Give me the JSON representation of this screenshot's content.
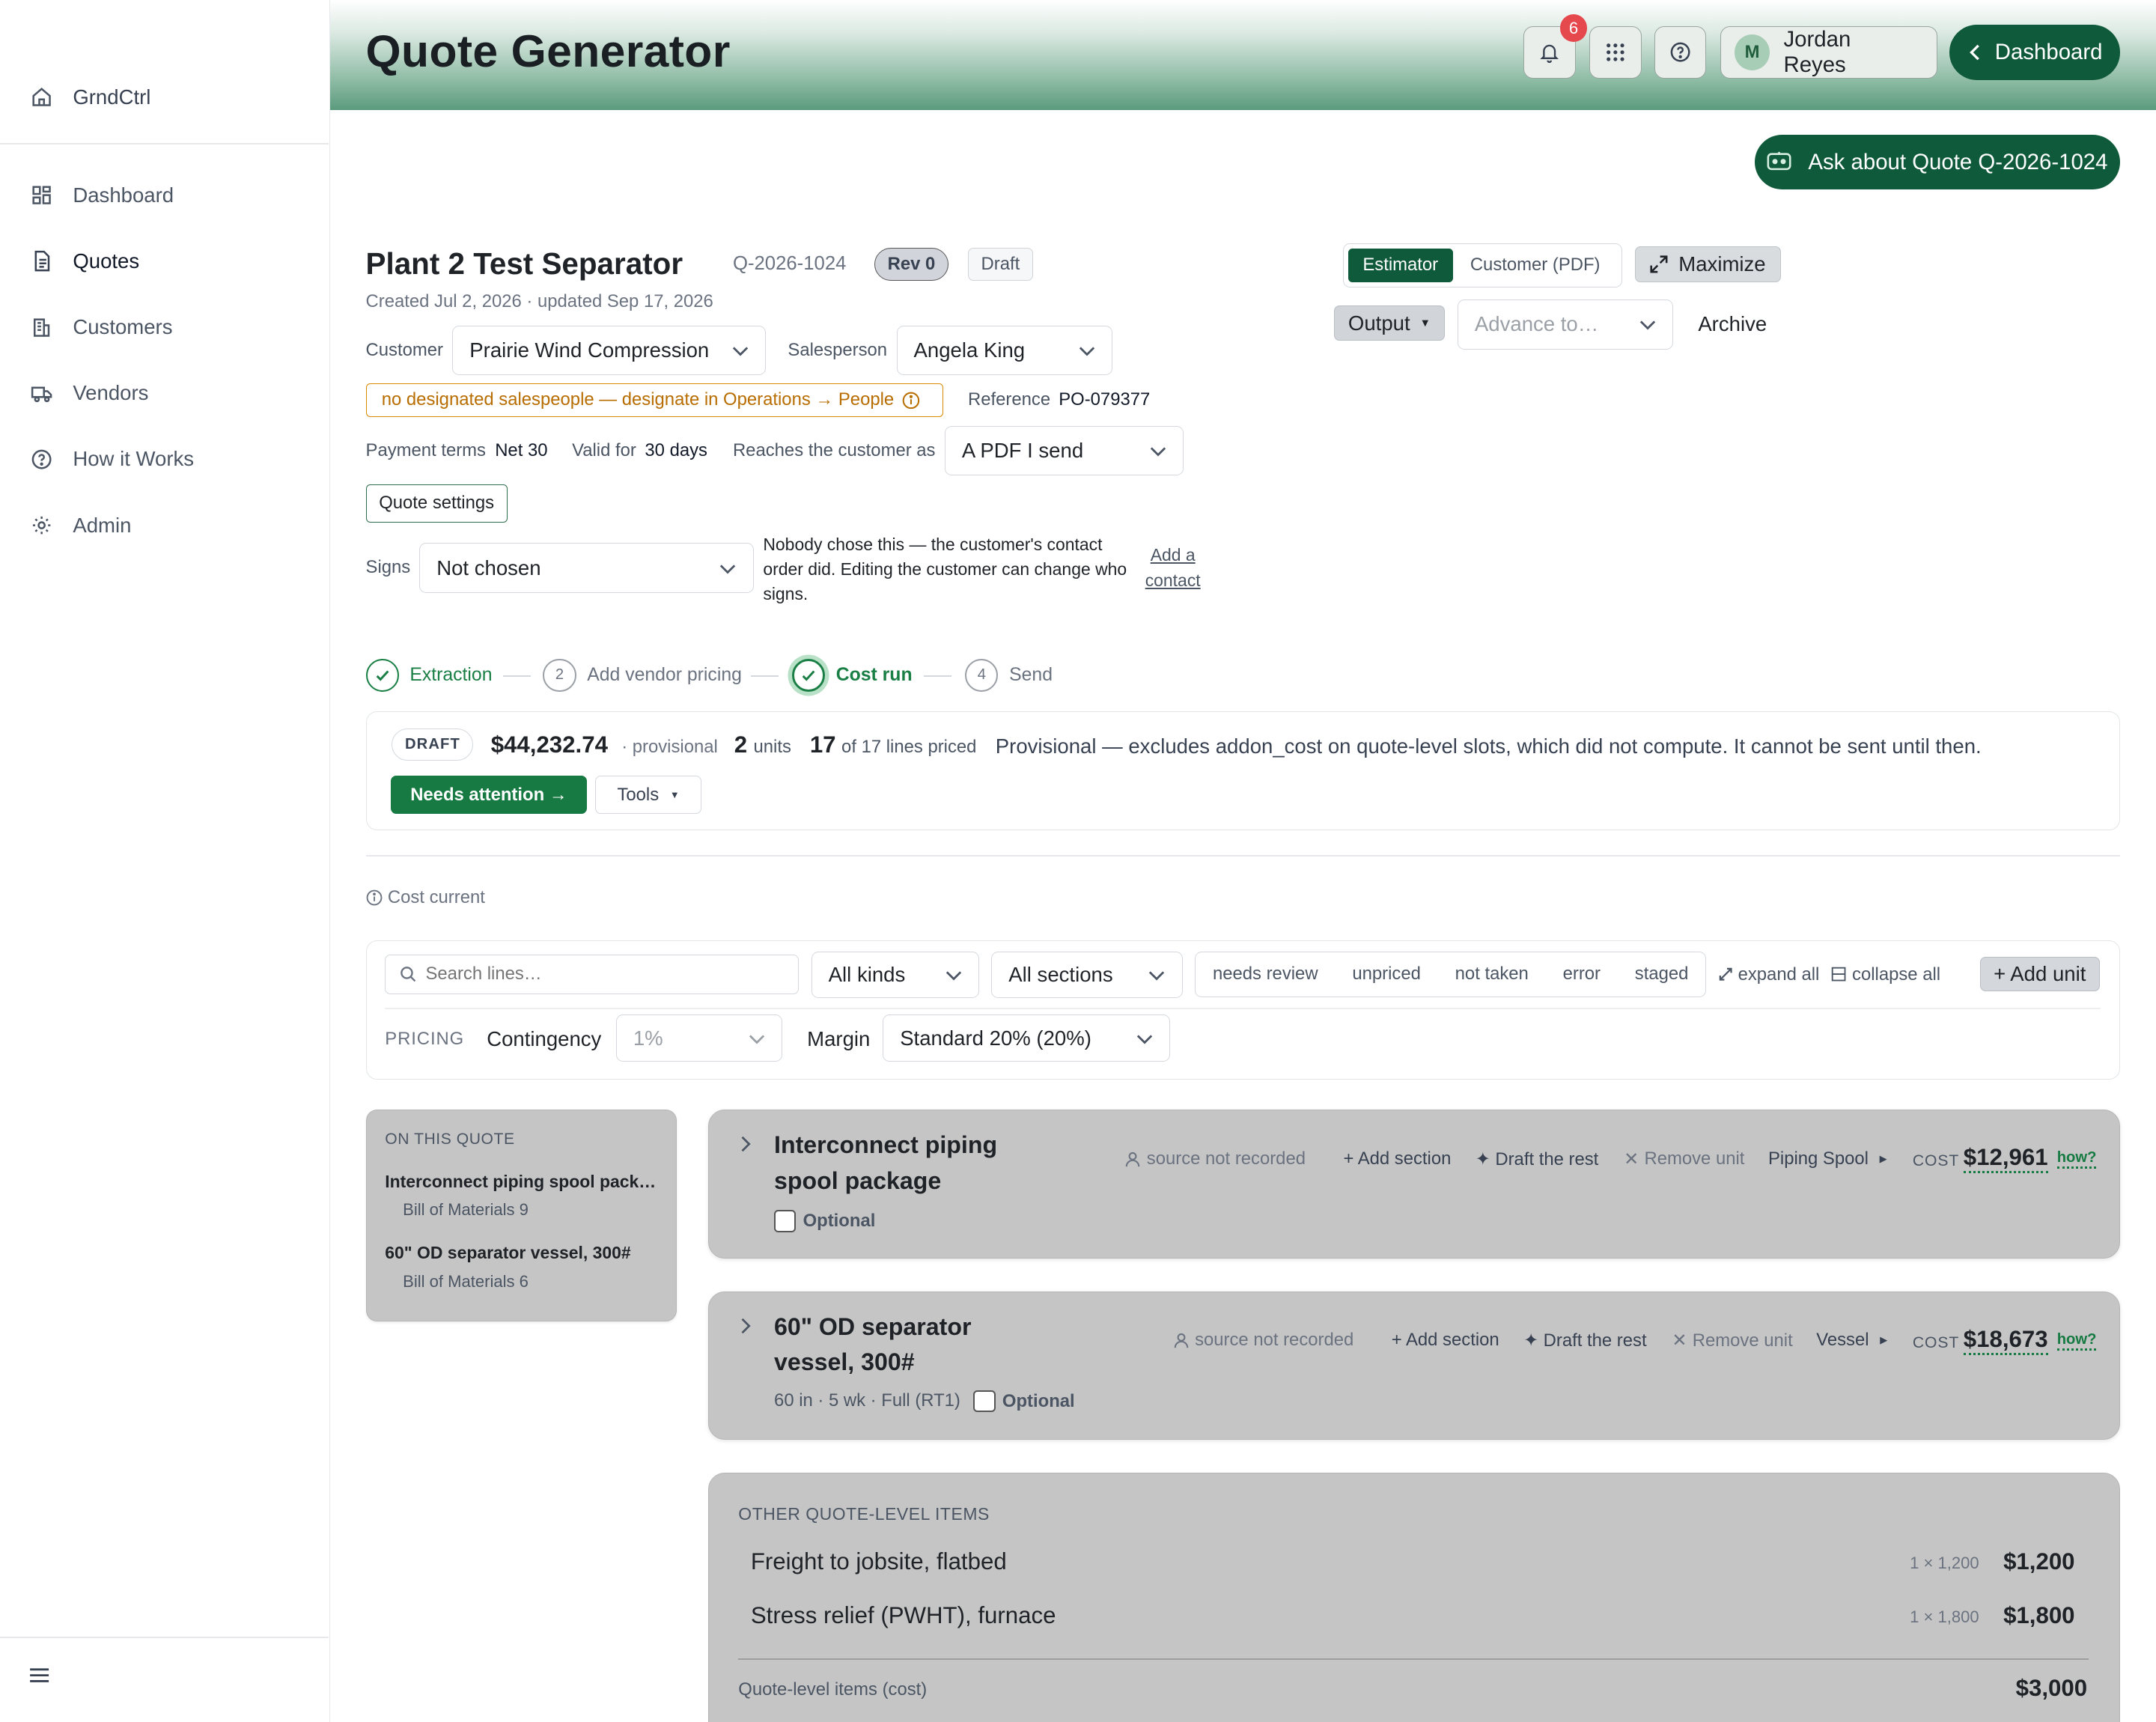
{
  "app": {
    "brand": "GrndCtrl",
    "page_title": "Quote Generator"
  },
  "sidebar": {
    "items": [
      {
        "label": "Dashboard",
        "icon": "dashboard-icon"
      },
      {
        "label": "Quotes",
        "icon": "document-icon",
        "active": true
      },
      {
        "label": "Customers",
        "icon": "building-icon"
      },
      {
        "label": "Vendors",
        "icon": "truck-icon"
      },
      {
        "label": "How it Works",
        "icon": "help-circle-icon"
      },
      {
        "label": "Admin",
        "icon": "gear-icon"
      }
    ]
  },
  "header": {
    "notifications_count": "6",
    "user_initial": "M",
    "user_name": "Jordan Reyes",
    "dashboard_label": "Dashboard",
    "ask_label": "Ask about Quote Q-2026-1024"
  },
  "quote": {
    "title": "Plant 2 Test Separator",
    "id": "Q-2026-1024",
    "rev": "Rev 0",
    "status": "Draft",
    "created": "Created Jul 2, 2026 · updated Sep 17, 2026",
    "customer_label": "Customer",
    "customer": "Prairie Wind Compression",
    "salesperson_label": "Salesperson",
    "salesperson": "Angela King",
    "warning": "no designated salespeople — designate in Operations → People",
    "reference_label": "Reference",
    "reference": "PO-079377",
    "payment_label": "Payment terms",
    "payment": "Net 30",
    "valid_label": "Valid for",
    "valid": "30 days",
    "reaches_label": "Reaches the customer as",
    "reaches": "A PDF I send",
    "settings_label": "Quote settings",
    "signs_label": "Signs",
    "signs": "Not chosen",
    "signs_note": "Nobody chose this — the customer's contact order did. Editing the customer can change who signs.",
    "add_contact": "Add a contact"
  },
  "view": {
    "estimator": "Estimator",
    "customer_pdf": "Customer (PDF)",
    "maximize": "Maximize",
    "output": "Output",
    "advance_placeholder": "Advance to…",
    "archive": "Archive"
  },
  "steps": [
    {
      "label": "Extraction",
      "state": "done"
    },
    {
      "num": "2",
      "label": "Add vendor pricing",
      "state": "todo"
    },
    {
      "label": "Cost run",
      "state": "current"
    },
    {
      "num": "4",
      "label": "Send",
      "state": "todo"
    }
  ],
  "summary": {
    "pill": "DRAFT",
    "total": "$44,232.74",
    "provisional": "· provisional",
    "units_n": "2",
    "units_label": "units",
    "lines_n": "17",
    "lines_label": "of 17 lines priced",
    "message": "Provisional — excludes addon_cost on quote-level slots, which did not compute. It cannot be sent until then.",
    "needs_attention": "Needs attention →",
    "tools": "Tools"
  },
  "cost_current": "Cost current",
  "filters": {
    "search_placeholder": "Search lines…",
    "kinds": "All kinds",
    "sections": "All sections",
    "chips": [
      "needs review",
      "unpriced",
      "not taken",
      "error",
      "staged"
    ],
    "expand_all": "expand all",
    "collapse_all": "collapse all",
    "add_unit": "+ Add unit",
    "pricing_label": "PRICING",
    "contingency_label": "Contingency",
    "contingency": "1%",
    "margin_label": "Margin",
    "margin": "Standard 20% (20%)"
  },
  "on_this_quote": {
    "heading": "ON THIS QUOTE",
    "items": [
      {
        "title": "Interconnect piping spool package",
        "sub": "Bill of Materials 9"
      },
      {
        "title": "60\" OD separator vessel, 300#",
        "sub": "Bill of Materials 6"
      }
    ]
  },
  "units": [
    {
      "title": "Interconnect piping spool package",
      "meta": "",
      "optional": "Optional",
      "source": "source not recorded",
      "add_section": "+ Add section",
      "draft_rest": "✦ Draft the rest",
      "remove": "Remove unit",
      "type": "Piping Spool",
      "cost_label": "COST",
      "cost": "$12,961",
      "how": "how?"
    },
    {
      "title": "60\" OD separator vessel, 300#",
      "meta": "60 in · 5 wk · Full (RT1)",
      "optional": "Optional",
      "source": "source not recorded",
      "add_section": "+ Add section",
      "draft_rest": "✦ Draft the rest",
      "remove": "Remove unit",
      "type": "Vessel",
      "cost_label": "COST",
      "cost": "$18,673",
      "how": "how?"
    }
  ],
  "other_items": {
    "heading": "OTHER QUOTE-LEVEL ITEMS",
    "rows": [
      {
        "name": "Freight to jobsite, flatbed",
        "qty": "1 × 1,200",
        "amount": "$1,200"
      },
      {
        "name": "Stress relief (PWHT), furnace",
        "qty": "1 × 1,800",
        "amount": "$1,800"
      }
    ],
    "total_label": "Quote-level items (cost)",
    "total": "$3,000"
  },
  "colors": {
    "brand_green": "#0f5a3a",
    "accent_green": "#177a42",
    "warning": "#d98a00",
    "badge_red": "#e5484d"
  }
}
